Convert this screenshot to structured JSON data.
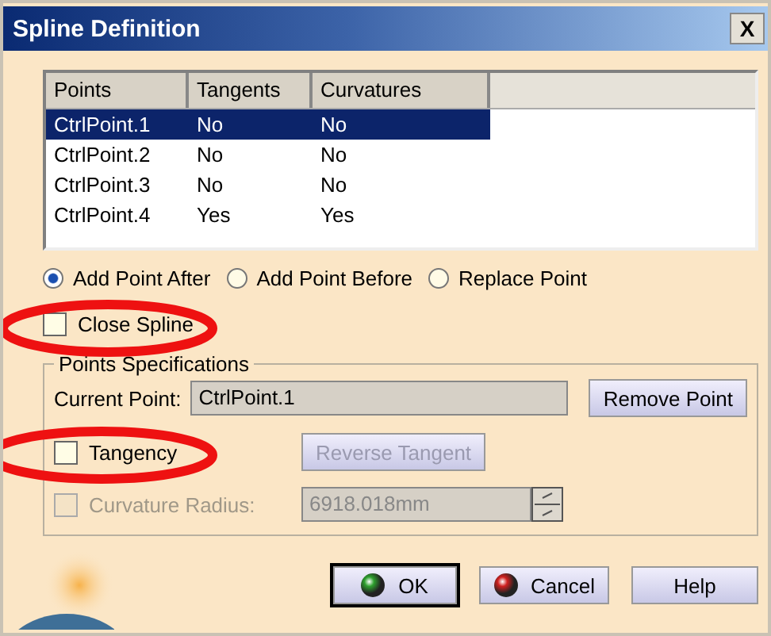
{
  "window": {
    "title": "Spline Definition",
    "close": "X"
  },
  "table": {
    "columns": [
      "Points",
      "Tangents",
      "Curvatures"
    ],
    "rows": [
      {
        "cells": [
          "CtrlPoint.1",
          "No",
          "No"
        ],
        "selected": true
      },
      {
        "cells": [
          "CtrlPoint.2",
          "No",
          "No"
        ],
        "selected": false
      },
      {
        "cells": [
          "CtrlPoint.3",
          "No",
          "No"
        ],
        "selected": false
      },
      {
        "cells": [
          "CtrlPoint.4",
          "Yes",
          "Yes"
        ],
        "selected": false
      }
    ]
  },
  "insert_mode": [
    {
      "label": "Add Point After",
      "selected": true
    },
    {
      "label": "Add Point Before",
      "selected": false
    },
    {
      "label": "Replace Point",
      "selected": false
    }
  ],
  "close_spline": {
    "label": "Close Spline",
    "checked": false
  },
  "points_specifications": {
    "title": "Points Specifications",
    "current_point": {
      "label": "Current Point:",
      "value": "CtrlPoint.1"
    },
    "remove_button": "Remove Point",
    "tangency": {
      "label": "Tangency",
      "checked": false
    },
    "reverse_tangent": {
      "label": "Reverse Tangent",
      "disabled": true
    },
    "curvature_radius": {
      "label": "Curvature Radius:",
      "checked": false,
      "disabled": true,
      "value": "6918.018mm"
    }
  },
  "buttons": [
    {
      "kind": "ok",
      "label": "OK"
    },
    {
      "kind": "cancel",
      "label": "Cancel"
    },
    {
      "kind": "help",
      "label": "Help"
    }
  ]
}
